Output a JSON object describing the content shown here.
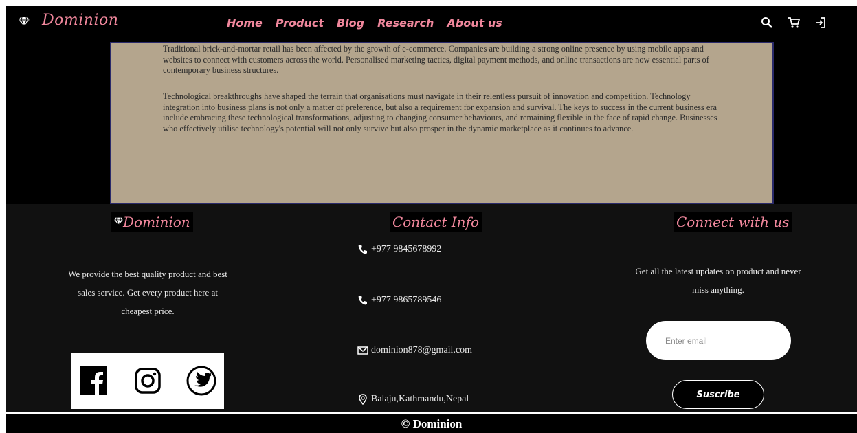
{
  "nav": {
    "brand": "Dominion",
    "menu": [
      "Home",
      "Product",
      "Blog",
      "Research",
      "About us"
    ],
    "icons": [
      "search-icon",
      "cart-icon",
      "login-icon"
    ]
  },
  "article": {
    "paragraphs": [
      "Traditional brick-and-mortar retail has been affected by the growth of e-commerce. Companies are building a strong online presence by using mobile apps and websites to connect with customers across the world. Personalised marketing tactics, digital payment methods, and online transactions are now essential parts of contemporary business structures.",
      "Technological breakthroughs have shaped the terrain that organisations must navigate in their relentless pursuit of innovation and competition. Technology integration into business plans is not only a matter of preference, but also a requirement for expansion and survival. The keys to success in the current business era include embracing these technological transformations, adjusting to changing consumer behaviours, and remaining flexible in the face of rapid change. Businesses who effectively utilise technology's potential will not only survive but also prosper in the dynamic marketplace as it continues to advance."
    ]
  },
  "footer": {
    "brand_title": "Dominion",
    "about_text": "We provide the best quality product and best sales service. Get every product here at cheapest price.",
    "social_icons": [
      "facebook-icon",
      "instagram-icon",
      "twitter-icon"
    ],
    "contact_title": "Contact Info",
    "contacts": {
      "phone1": "+977 9845678992",
      "phone2": "+977 9865789546",
      "email": "dominion878@gmail.com",
      "address": "Balaju,Kathmandu,Nepal"
    },
    "connect_title": "Connect with us",
    "connect_text": "Get all the latest updates on product and never miss anything.",
    "email_placeholder": "Enter email",
    "subscribe_label": "Suscribe",
    "copyright": "© Dominion"
  },
  "colors": {
    "accent": "#f0879c",
    "article_bg": "#b4a58d",
    "footer_bg": "#111111",
    "nav_bg": "#000000"
  }
}
